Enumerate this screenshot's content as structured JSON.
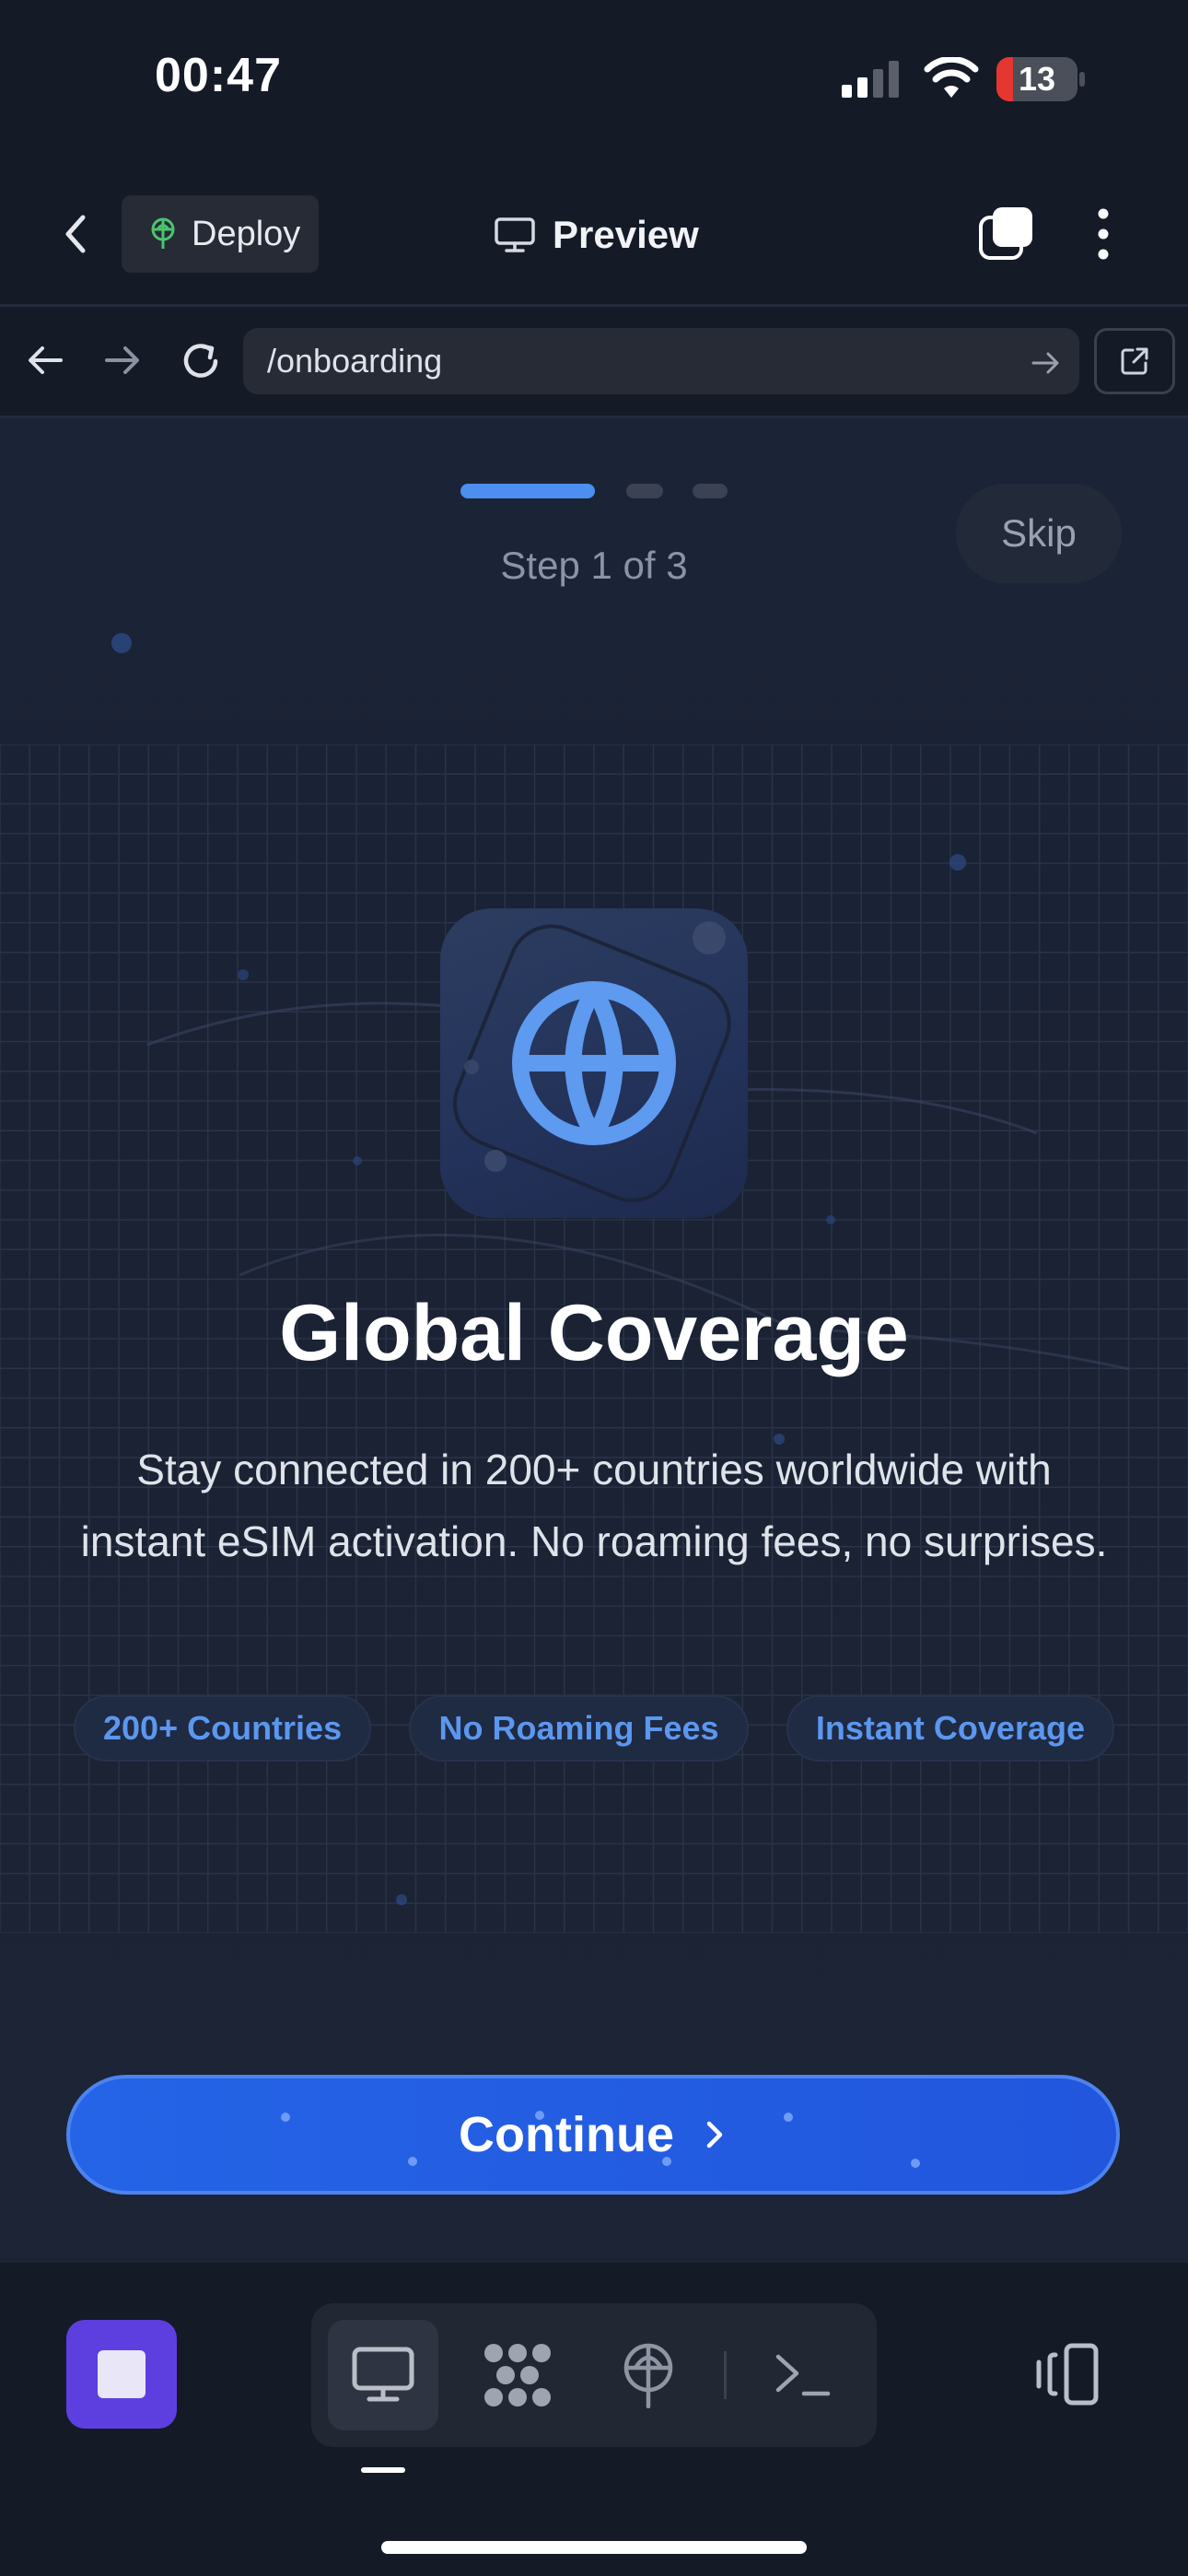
{
  "status_bar": {
    "time": "00:47",
    "battery_level": "13"
  },
  "header": {
    "deploy_label": "Deploy",
    "preview_label": "Preview"
  },
  "browser": {
    "url": "/onboarding"
  },
  "onboarding": {
    "step_label": "Step 1 of 3",
    "current_step": 1,
    "total_steps": 3,
    "skip_label": "Skip",
    "title": "Global Coverage",
    "description": "Stay connected in 200+ countries worldwide with instant eSIM activation. No roaming fees, no surprises.",
    "features": [
      "200+ Countries",
      "No Roaming Fees",
      "Instant Coverage"
    ],
    "continue_label": "Continue",
    "hero_icon": "globe-icon"
  },
  "toolbar": {
    "tools": [
      "desktop-icon",
      "apps-icon",
      "deploy-icon",
      "terminal-icon"
    ],
    "active_tool": "desktop-icon"
  },
  "colors": {
    "accent": "#2564e6",
    "chip_text": "#5b97ee",
    "stop_button": "#5d3fe0",
    "deploy_icon": "#4cc46f",
    "battery_low": "#e5362f"
  }
}
